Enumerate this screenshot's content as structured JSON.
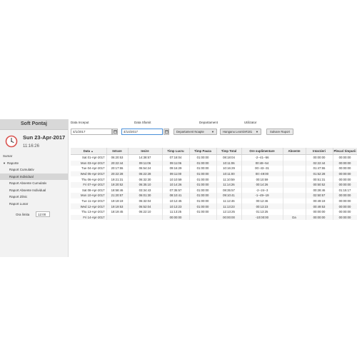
{
  "app": {
    "title": "Soft Pontaj"
  },
  "clock": {
    "date": "Sun 23-Apr-2017",
    "time": "11:16:26",
    "icon": "clock-icon",
    "accent": "#d9534f"
  },
  "nav": {
    "items": [
      {
        "label": "Sumar",
        "level": 0,
        "selected": false
      },
      {
        "label": "Raporte",
        "level": 0,
        "selected": false,
        "expanded": true
      },
      {
        "label": "Raport Cumulativ",
        "level": 1,
        "selected": false
      },
      {
        "label": "Raport Individual",
        "level": 1,
        "selected": true
      },
      {
        "label": "Raport Absente Cumulativ",
        "level": 1,
        "selected": false
      },
      {
        "label": "Raport Absente Individual",
        "level": 1,
        "selected": false
      },
      {
        "label": "Raport Zilnic",
        "level": 1,
        "selected": false
      },
      {
        "label": "Raport Lunar",
        "level": 1,
        "selected": false
      }
    ],
    "ora_limita": {
      "label": "Ora limita",
      "value": "12:00"
    }
  },
  "filters": {
    "start": {
      "label": "Data Inceput",
      "value": "4/1/2017"
    },
    "end": {
      "label": "Data Sfarsit",
      "value": "4/14/2017"
    },
    "department": {
      "label": "Departament",
      "value": "Departament Noapte"
    },
    "user": {
      "label": "Utilizator",
      "value": "Hanganu Leontin#181"
    },
    "save_label": "Salvare Raport"
  },
  "table": {
    "columns": [
      "Data",
      "Intrare",
      "Iesire",
      "Timp Lucru",
      "Timp Pauza",
      "Timp Total",
      "Ore suplimentare",
      "Absente",
      "Intarzieri",
      "Plecari timpurii"
    ],
    "sort_indicator": "▲",
    "rows": [
      [
        "Sat 01-Apr-2017",
        "06:20:53",
        "14:38:57",
        "07:18:04",
        "01:00:00",
        "08:18:04",
        "-2--41--56",
        "",
        "00:00:00",
        "00:00:00"
      ],
      [
        "Mon 03-Apr-2017",
        "20:22:44",
        "09:11:06",
        "09:11:06",
        "01:00:00",
        "10:11:06",
        "00:48--54",
        "",
        "02:22:44",
        "00:00:00"
      ],
      [
        "Tue 04-Apr-2017",
        "20:17:55",
        "06:54:24",
        "09:16:29",
        "01:00:00",
        "10:16:29",
        "00:-43--31",
        "",
        "01:47:55",
        "00:00:00"
      ],
      [
        "Wed 05-Apr-2017",
        "20:22:28",
        "06:22:28",
        "09:11:00",
        "01:00:00",
        "10:11:00",
        "00:-49:00",
        "",
        "01:52:28",
        "00:00:00"
      ],
      [
        "Thu 06-Apr-2017",
        "19:21:31",
        "06:32:30",
        "10:10:59",
        "01:00:00",
        "11:10:59",
        "00:10:59",
        "",
        "00:51:31",
        "00:00:00"
      ],
      [
        "Fri 07-Apr-2017",
        "19:20:52",
        "06:35:10",
        "10:14:26",
        "01:00:00",
        "11:14:26",
        "00:14:26",
        "",
        "00:50:52",
        "00:00:00"
      ],
      [
        "Sat 08-Apr-2017",
        "18:58:46",
        "03:34:43",
        "07:35:57",
        "01:00:00",
        "08:35:57",
        "-2--24--3",
        "",
        "00:28:46",
        "01:15:17"
      ],
      [
        "Mon 10-Apr-2017",
        "21:20:57",
        "06:01:30",
        "08:10:41",
        "01:00:00",
        "09:10:41",
        "-1--49--19",
        "",
        "02:50:57",
        "00:00:00"
      ],
      [
        "Tue 11-Apr-2017",
        "19:19:19",
        "06:32:04",
        "10:12:45",
        "01:00:00",
        "11:12:46",
        "00:12:46",
        "",
        "00:49:19",
        "00:00:00"
      ],
      [
        "Wed 12-Apr-2017",
        "19:19:53",
        "06:52:04",
        "10:13:23",
        "01:00:00",
        "11:13:23",
        "00:13:23",
        "",
        "00:49:53",
        "00:00:00"
      ],
      [
        "Thu 13-Apr-2017",
        "18:19:45",
        "06:22:10",
        "11:13:25",
        "01:00:00",
        "12:13:25",
        "01:13:25",
        "",
        "00:00:00",
        "00:00:00"
      ],
      [
        "Fri 14-Apr-2017",
        "",
        "",
        "00:00:00",
        "",
        "00:00:00",
        "-10:00:00",
        "Da",
        "00:00:00",
        "00:00:00"
      ]
    ]
  }
}
